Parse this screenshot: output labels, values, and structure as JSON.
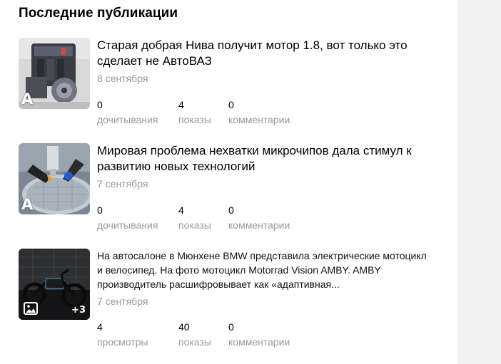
{
  "section_title": "Последние публикации",
  "publications": [
    {
      "title": "Старая добрая Нива получит мотор 1.8, вот только это сделает не АвтоВАЗ",
      "date": "8 сентября",
      "badge": "A",
      "stats": [
        {
          "value": "0",
          "label": "дочитывания"
        },
        {
          "value": "4",
          "label": "показы"
        },
        {
          "value": "0",
          "label": "комментарии"
        }
      ]
    },
    {
      "title": "Мировая проблема нехватки микрочипов дала стимул к развитию новых технологий",
      "date": "7 сентября",
      "badge": "A",
      "stats": [
        {
          "value": "0",
          "label": "дочитывания"
        },
        {
          "value": "4",
          "label": "показы"
        },
        {
          "value": "0",
          "label": "комментарии"
        }
      ]
    },
    {
      "title": "На автосалоне в Мюнхене BMW представила электрические мотоцикл и велосипед. На фото мотоцикл Motorrad Vision AMBY. AMBY производитель расшифровывает как «адаптивная...",
      "date": "7 сентября",
      "gallery_count": "+3",
      "stats": [
        {
          "value": "4",
          "label": "просмотры"
        },
        {
          "value": "40",
          "label": "показы"
        },
        {
          "value": "0",
          "label": "комментарии"
        }
      ]
    }
  ]
}
